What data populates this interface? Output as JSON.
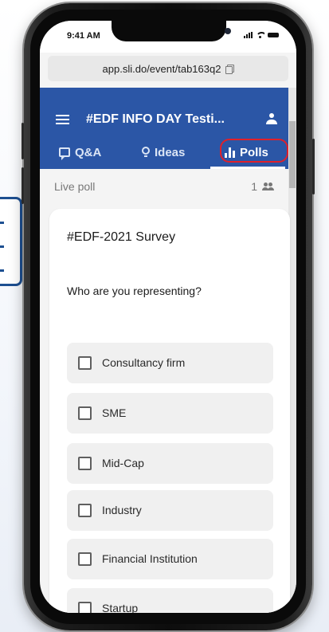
{
  "device": {
    "status_time": "9:41 AM"
  },
  "browser": {
    "url": "app.sli.do/event/tab163q2"
  },
  "header": {
    "event_title": "#EDF INFO DAY Testi...",
    "tabs": [
      {
        "label": "Q&A",
        "icon": "chat-icon",
        "active": false
      },
      {
        "label": "Ideas",
        "icon": "lightbulb-icon",
        "active": false
      },
      {
        "label": "Polls",
        "icon": "bar-chart-icon",
        "active": true
      }
    ],
    "brand_color": "#2b56a6",
    "highlight_color": "#e0202a"
  },
  "poll_status": {
    "label": "Live poll",
    "participant_count": "1"
  },
  "poll": {
    "title": "#EDF-2021 Survey",
    "question": "Who are you representing?",
    "options": [
      {
        "label": "Consultancy firm",
        "checked": false
      },
      {
        "label": "SME",
        "checked": false
      },
      {
        "label": "Mid-Cap",
        "checked": false
      },
      {
        "label": "Industry",
        "checked": false
      },
      {
        "label": "Financial Institution",
        "checked": false
      },
      {
        "label": "Startup",
        "checked": false
      }
    ]
  }
}
